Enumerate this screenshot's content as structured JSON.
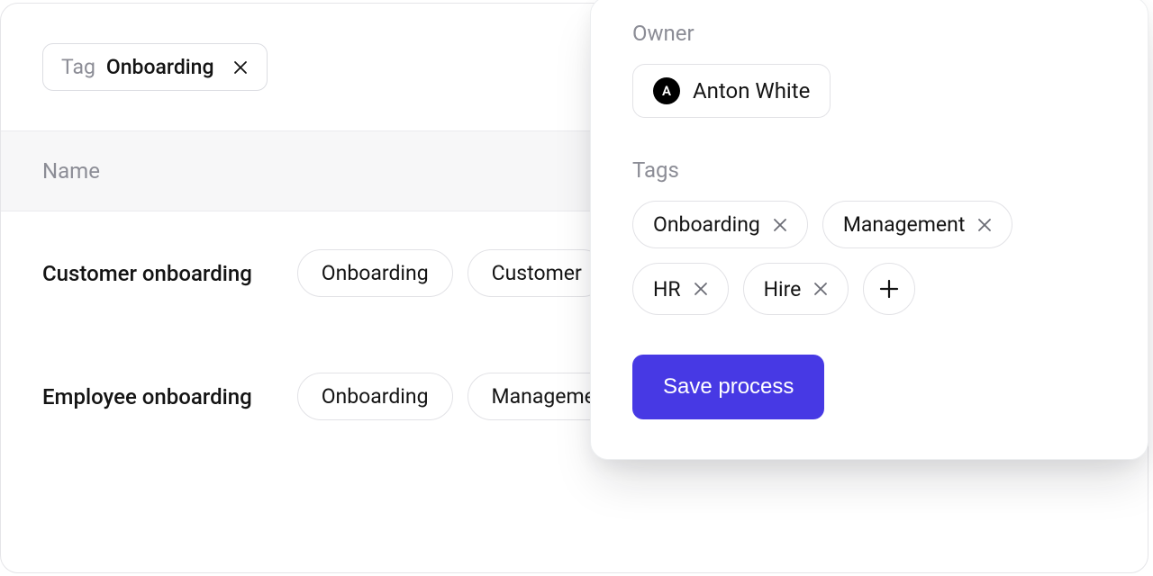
{
  "filter": {
    "label": "Tag",
    "value": "Onboarding"
  },
  "listHeader": {
    "name": "Name"
  },
  "rows": [
    {
      "name": "Customer onboarding",
      "tags": [
        "Onboarding",
        "Customer"
      ]
    },
    {
      "name": "Employee onboarding",
      "tags": [
        "Onboarding",
        "Management"
      ]
    }
  ],
  "panel": {
    "ownerLabel": "Owner",
    "ownerInitial": "A",
    "ownerName": "Anton White",
    "tagsLabel": "Tags",
    "tags": [
      "Onboarding",
      "Management",
      "HR",
      "Hire"
    ],
    "saveLabel": "Save process"
  }
}
